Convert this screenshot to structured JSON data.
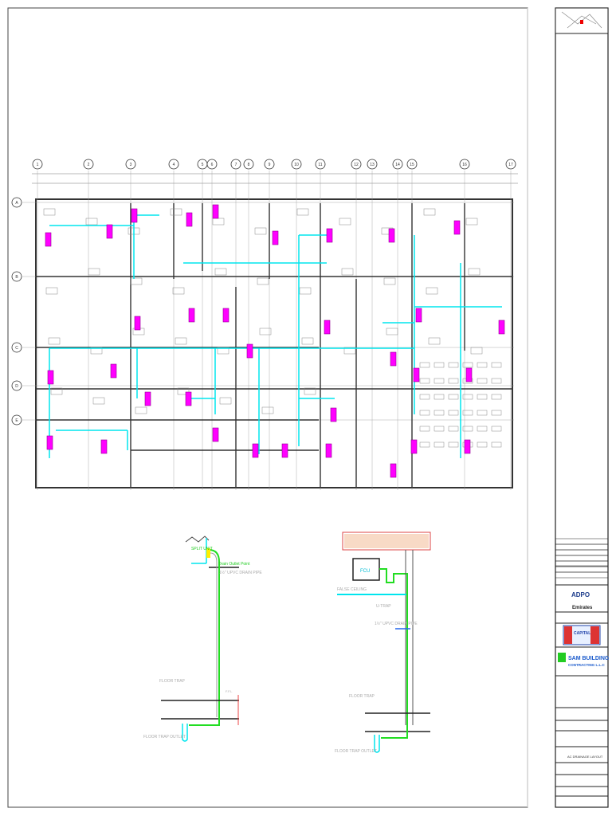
{
  "grid": {
    "columns": [
      "1",
      "2",
      "3",
      "4",
      "5",
      "6",
      "7",
      "8",
      "9",
      "10",
      "11",
      "12",
      "13",
      "14",
      "15",
      "16",
      "17"
    ],
    "rows": [
      "A",
      "B",
      "C",
      "D",
      "E"
    ]
  },
  "detail_split_unit": {
    "unit_label": "SPLIT UNIT",
    "outlet_label": "Drain Outlet Point",
    "pipe_label": "1½\" UPVC DRAIN PIPE",
    "floor_trap_label": "FLOOR TRAP",
    "trap_outlet_label": "FLOOR TRAP OUTLET",
    "ffl_label": "F.F.L"
  },
  "detail_fcu": {
    "unit_label": "FCU",
    "ceiling_label": "FALSE CEILING",
    "trap_label": "U-TRAP",
    "pipe_label": "1½\" UPVC DRAIN PIPE",
    "floor_trap_label": "FLOOR TRAP",
    "trap_outlet_label": "FLOOR TRAP OUTLET"
  },
  "title_block": {
    "consultant_logo": "ADPO",
    "consultant_sub": "Emirates",
    "client_logo": "CAPITAL",
    "contractor_name": "SAM BUILDING",
    "contractor_sub": "CONTRACTING L.L.C",
    "drawing_title": "AC DRAINAGE LAYOUT"
  },
  "colors": {
    "pipe": "#00e5ee",
    "unit": "#ff00ff",
    "drain": "#22dd22",
    "wall": "#333333"
  }
}
